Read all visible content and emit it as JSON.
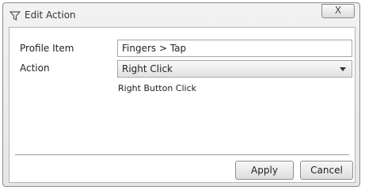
{
  "window": {
    "title": "Edit Action",
    "title_icon": "funnel-icon",
    "close_symbol": "X"
  },
  "form": {
    "profile_item_label": "Profile Item",
    "profile_item_value": "Fingers > Tap",
    "action_label": "Action",
    "action_selected": "Right Click",
    "action_description": "Right Button Click"
  },
  "buttons": {
    "apply": "Apply",
    "cancel": "Cancel"
  }
}
